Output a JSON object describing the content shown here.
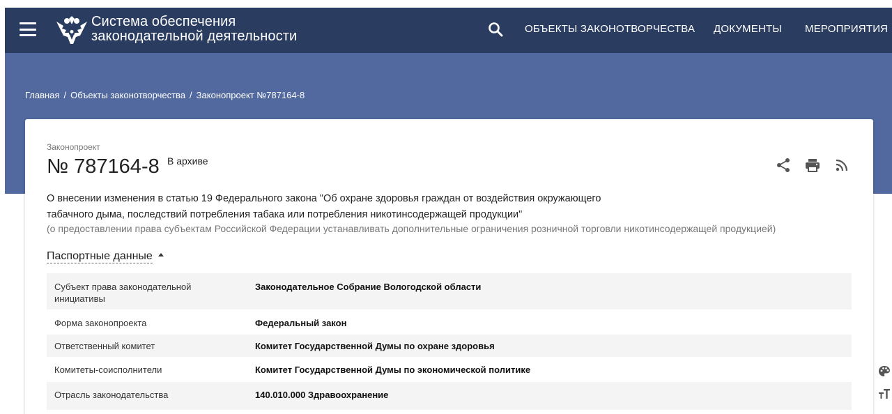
{
  "header": {
    "brand_line1": "Система обеспечения",
    "brand_line2": "законодательной деятельности",
    "nav": [
      "ОБЪЕКТЫ ЗАКОНОТВОРЧЕСТВА",
      "ДОКУМЕНТЫ",
      "МЕРОПРИЯТИЯ"
    ]
  },
  "breadcrumb": {
    "items": [
      "Главная",
      "Объекты законотворчества",
      "Законопроект №787164-8"
    ],
    "separator": "/"
  },
  "bill": {
    "type_label": "Законопроект",
    "number": "№ 787164-8",
    "status": "В архиве",
    "title_line1": "О внесении изменения в статью 19 Федерального закона \"Об охране здоровья граждан от воздействия окружающего",
    "title_line2": "табачного дыма, последствий потребления табака или потребления никотинсодержащей продукции\"",
    "subtitle": "(о предоставлении права субъектам Российской Федерации устанавливать дополнительные ограничения розничной торговли никотинсодержащей продукцией)"
  },
  "passport": {
    "toggle_label": "Паспортные данные",
    "rows": [
      {
        "key_line1": "Субъект права законодательной",
        "key_line2": "инициативы",
        "value": "Законодательное Собрание Вологодской области"
      },
      {
        "key": "Форма законопроекта",
        "value": "Федеральный закон"
      },
      {
        "key": "Ответственный комитет",
        "value": "Комитет Государственной Думы по охране здоровья"
      },
      {
        "key": "Комитеты-соисполнители",
        "value": "Комитет Государственной Думы по экономической политике"
      },
      {
        "key": "Отрасль законодательства",
        "value": "140.010.000 Здравоохранение"
      }
    ]
  },
  "icons": {
    "menu": "hamburger-icon",
    "emblem": "emblem-icon",
    "search": "search-icon",
    "share": "share-icon",
    "print": "print-icon",
    "rss": "rss-icon",
    "palette": "palette-icon",
    "font_size": "font-size-icon"
  },
  "colors": {
    "header_bg": "#2a3c60",
    "hero_bg": "#51699f",
    "card_bg": "#ffffff",
    "row_alt_bg": "#f4f4f4",
    "muted_text": "#777777"
  }
}
